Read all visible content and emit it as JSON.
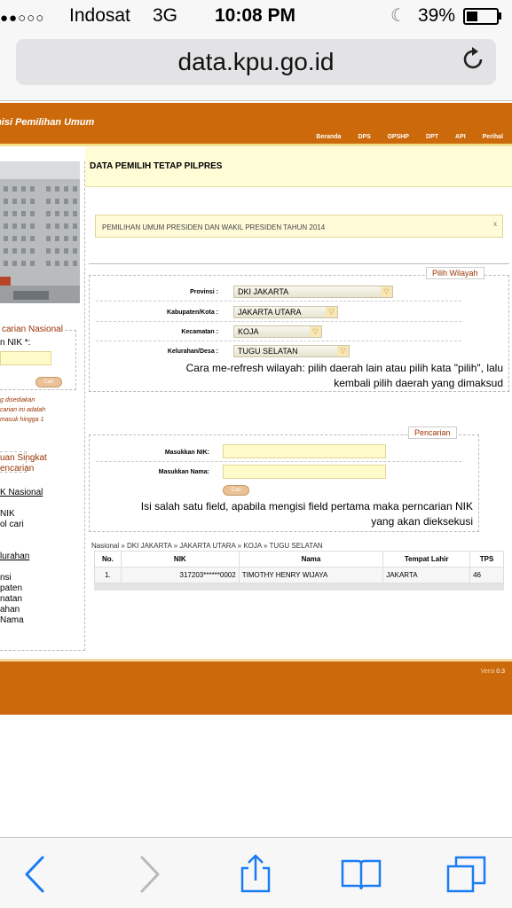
{
  "status_bar": {
    "signal": "●●○○○",
    "carrier": "Indosat",
    "network": "3G",
    "time": "10:08 PM",
    "battery_percent": "39%",
    "battery_level": 0.39
  },
  "browser": {
    "url": "data.kpu.go.id"
  },
  "site": {
    "name": "misi Pemilihan Umum",
    "nav": [
      "Beranda",
      "DPS",
      "DPSHP",
      "DPT",
      "API",
      "Perihal"
    ],
    "brand_color": "#cc6a0b"
  },
  "sidebar": {
    "search_legend": "carian Nasional",
    "nik_label": "n NIK *:",
    "search_button": "Cari",
    "note_lines": [
      "g disediakan",
      "carian ini adalah",
      "masuk hingga 1"
    ],
    "guide_legend_lines": [
      "uan Singkat",
      "encarian"
    ],
    "links": [
      "K Nasional",
      "",
      "NIK",
      "ol cari",
      "",
      "",
      "lurahan",
      "",
      "nsi",
      "paten",
      "natan",
      "ahan",
      "Nama"
    ]
  },
  "main": {
    "title": "DATA PEMILIH TETAP PILPRES",
    "notice": "PEMILIHAN UMUM PRESIDEN DAN WAKIL PRESIDEN TAHUN 2014",
    "notice_close": "x",
    "region": {
      "legend": "Pilih Wilayah",
      "provinsi_label": "Provinsi :",
      "provinsi_value": "DKI JAKARTA",
      "kabupaten_label": "Kabupaten/Kota :",
      "kabupaten_value": "JAKARTA UTARA",
      "kecamatan_label": "Kecamatan :",
      "kecamatan_value": "KOJA",
      "kelurahan_label": "Kelurahan/Desa :",
      "kelurahan_value": "TUGU SELATAN",
      "help_line1": "Cara me-refresh wilayah: pilih daerah lain atau pilih kata \"pilih\", lalu",
      "help_line2": "kembali pilih daerah yang dimaksud"
    },
    "search": {
      "legend": "Pencarian",
      "nik_label": "Masukkan NIK:",
      "nama_label": "Masukkan Nama:",
      "button": "Cari",
      "help_line1": "Isi salah satu field, apabila mengisi field pertama maka perncarian NIK",
      "help_line2": "yang akan dieksekusi"
    },
    "breadcrumb": "Nasional » DKI JAKARTA » JAKARTA UTARA » KOJA » TUGU SELATAN",
    "table": {
      "headers": [
        "No.",
        "NIK",
        "Nama",
        "Tempat Lahir",
        "TPS"
      ],
      "rows": [
        [
          "1.",
          "317203******0002",
          "TIMOTHY HENRY WIJAYA",
          "JAKARTA",
          "46"
        ]
      ]
    }
  },
  "footer": {
    "version_label": "Versi",
    "version": "0.3"
  },
  "toolbar": {
    "icons": [
      "back-icon",
      "forward-icon",
      "share-icon",
      "bookmarks-icon",
      "tabs-icon"
    ]
  }
}
